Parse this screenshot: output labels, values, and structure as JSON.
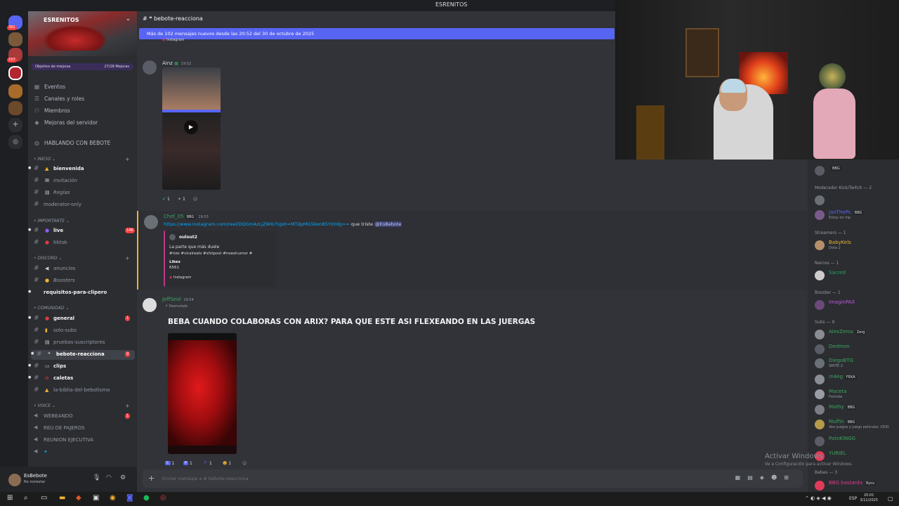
{
  "window": {
    "title": "ESRENITOS"
  },
  "server": {
    "name": "ESRENITOS",
    "boost_goal": "Objetivo de mejoras",
    "boost_progress": "27/28 Mejoras",
    "menu": [
      "Eventos",
      "Canales y roles",
      "Miembros",
      "Mejoras del servidor",
      "HABLANDO CON BEBOTE"
    ]
  },
  "guild_badges": [
    "391",
    "157"
  ],
  "categories": {
    "inicio": "INICIO",
    "importante": "IMPORTANTE",
    "discord": "DISCORD",
    "comunidad": "COMUNIDAD",
    "voice": "VOICE"
  },
  "channels": [
    {
      "name": "bienvenida",
      "bold": true
    },
    {
      "name": "invitación",
      "italic": true
    },
    {
      "name": "Reglas",
      "italic": true
    },
    {
      "name": "moderator-only"
    },
    {
      "name": "live",
      "bold": true,
      "badge": "146"
    },
    {
      "name": "tiktok"
    },
    {
      "name": "anuncios"
    },
    {
      "name": "Boosters",
      "italic": true
    },
    {
      "name": "requisitos-para-clipero",
      "bold": true
    },
    {
      "name": "general",
      "bold": true,
      "badge": "1"
    },
    {
      "name": "solo-subs"
    },
    {
      "name": "pruebas-suscriptores"
    },
    {
      "name": "bebote-reacciona",
      "selected": true,
      "badge": "9"
    },
    {
      "name": "clips",
      "bold": true
    },
    {
      "name": "caletas",
      "bold": true
    },
    {
      "name": "la-biblia-del-bebotismo"
    }
  ],
  "voice_channels": [
    {
      "name": "WEBEANDO",
      "badge": "1"
    },
    {
      "name": "REU DE PAJEROS"
    },
    {
      "name": "REUNION EJECUTIVA"
    }
  ],
  "user": {
    "name": "EsBebote",
    "status": "No molestar"
  },
  "chat": {
    "channel": "bebote-reacciona",
    "new_messages_bar": "Más de 102 mensajes nuevos desde las 20:52 del 30 de octubre de 2025",
    "top_embed_label": "Instagram",
    "messages": [
      {
        "author": "Ainz",
        "time": "19:52",
        "reactions": [
          "1",
          "1"
        ]
      },
      {
        "author": "Chef_05",
        "tag": "BBG",
        "time": "19:53",
        "link": "https://www.instagram.com/reel/DQGmAzLjZWX/?igsh=MTdpMG5kenB5YzIrdg==",
        "text": "que triste",
        "mention": "@EsBebote",
        "embed_author": "oulout2",
        "embed_line1": "La parte que más duele",
        "embed_line2": "#rize #viralreels #shitpost #noeshumor #",
        "embed_likes_label": "Likes",
        "embed_likes": "6561",
        "embed_source": "Instagram"
      },
      {
        "author": "JeffSeid",
        "time": "19:54",
        "forwarded": "Reenviado",
        "headline": "BEBA CUANDO COLABORAS CON ARIX? PARA QUE ESTE ASI FLEXEANDO EN LAS JUERGAS",
        "reactions": [
          "1",
          "1",
          "1",
          "1"
        ]
      }
    ],
    "composer_placeholder": "Enviar mensaje a # bebote-reacciona"
  },
  "members": {
    "groups": [
      {
        "label": "Moderador Kick/Twitch — 2"
      },
      {
        "label": "Streamers — 1"
      },
      {
        "label": "Narcos — 1"
      },
      {
        "label": "Booster — 1"
      },
      {
        "label": "Subs — 9"
      },
      {
        "label": "Bebes — 3"
      }
    ],
    "list": [
      {
        "name": "",
        "tag": "BBG",
        "color": "#a09de0"
      },
      {
        "name": "",
        "color": "#e03b3b"
      },
      {
        "name": "janThePc",
        "tag": "BBG",
        "sub": "Estoy en mp",
        "color": "#5865f2"
      },
      {
        "name": "BabyKels",
        "sub": "Dota 2",
        "color": "#f0b232"
      },
      {
        "name": "Sacred",
        "color": "#23a55a"
      },
      {
        "name": "ImaginPAX",
        "color": "#c155e0"
      },
      {
        "name": "AlexZeros",
        "tag": "Zerg",
        "color": "#3ba55d"
      },
      {
        "name": "Dedmon",
        "color": "#3ba55d"
      },
      {
        "name": "DiegoBTG",
        "sub": "SMITE 2",
        "color": "#3ba55d"
      },
      {
        "name": "m4eg",
        "tag": "FEKA",
        "color": "#3ba55d"
      },
      {
        "name": "Maceta",
        "sub": "Fortnite",
        "color": "#3ba55d"
      },
      {
        "name": "Mathy",
        "tag": "BBG",
        "color": "#3ba55d"
      },
      {
        "name": "Muffin",
        "tag": "BBG",
        "sub": "Veo juegos y juego películas :DDD",
        "color": "#3ba55d"
      },
      {
        "name": "PatoKINGG",
        "color": "#3ba55d"
      },
      {
        "name": "YURIEL",
        "color": "#3ba55d"
      },
      {
        "name": "BBG bastarda",
        "tag": "Ryns",
        "color": "#e03b8a"
      }
    ]
  },
  "watermark": {
    "title": "Activar Windows",
    "subtitle": "Ve a Configuración para activar Windows."
  },
  "taskbar": {
    "time": "20:01",
    "date": "3/11/2025",
    "lang": "ESP"
  }
}
